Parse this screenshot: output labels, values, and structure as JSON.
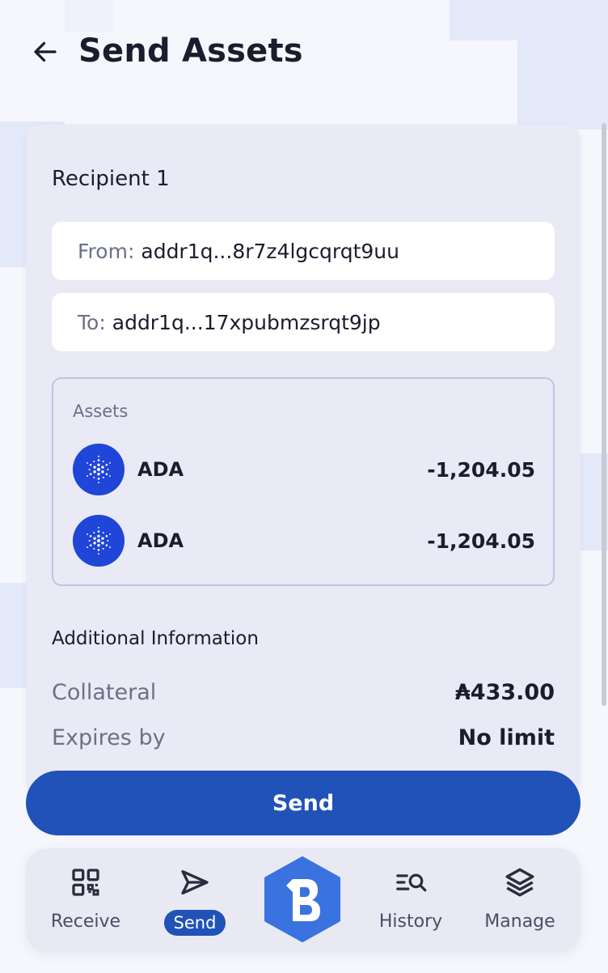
{
  "header": {
    "title": "Send Assets",
    "back_icon": "arrow-left-icon"
  },
  "recipient": {
    "title": "Recipient 1",
    "from_label": "From:",
    "from_value": "addr1q...8r7z4lgcqrqt9uu",
    "to_label": "To:",
    "to_value": "addr1q...17xpubmzsrqt9jp"
  },
  "assets": {
    "title": "Assets",
    "items": [
      {
        "name": "ADA",
        "amount": "-1,204.05",
        "icon": "cardano-icon"
      },
      {
        "name": "ADA",
        "amount": "-1,204.05",
        "icon": "cardano-icon"
      }
    ]
  },
  "additional": {
    "title": "Additional Information",
    "collateral_label": "Collateral",
    "collateral_value": "₳433.00",
    "expires_label": "Expires by",
    "expires_value": "No limit"
  },
  "send_button": {
    "label": "Send"
  },
  "nav": {
    "receive": {
      "label": "Receive",
      "icon": "qr-code-icon"
    },
    "send": {
      "label": "Send",
      "icon": "send-icon",
      "active": true
    },
    "center": {
      "icon": "app-logo-icon"
    },
    "history": {
      "label": "History",
      "icon": "history-search-icon"
    },
    "manage": {
      "label": "Manage",
      "icon": "layers-icon"
    }
  },
  "colors": {
    "primary": "#2052b8",
    "card_bg": "#e9eaf5",
    "asset_icon_bg": "#1f45d9",
    "logo_bg": "#3a73e0",
    "text_dark": "#1b1d2e",
    "text_muted": "#6c7088"
  }
}
